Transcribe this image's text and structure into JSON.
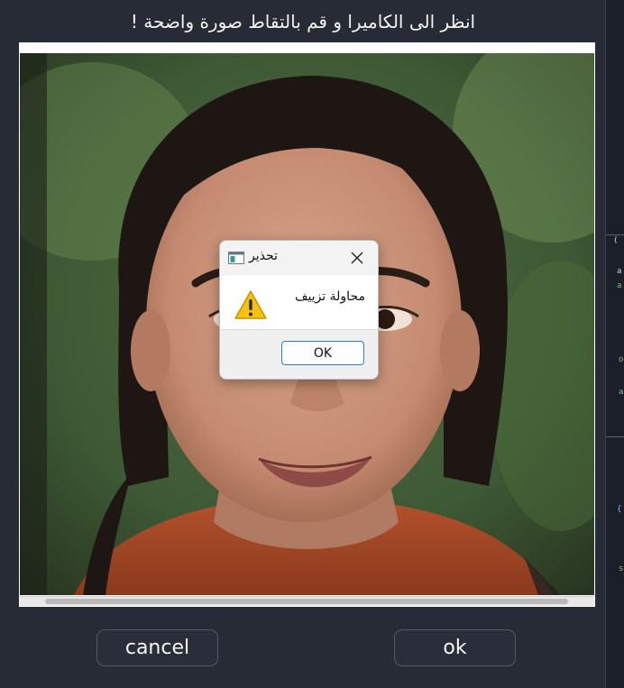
{
  "window": {
    "title": "انظر الى الكاميرا و قم بالتقاط صورة واضحة !"
  },
  "camera_preview": {
    "content": "photo",
    "scroll_fraction": 0.0
  },
  "buttons": {
    "cancel_label": "cancel",
    "ok_label": "ok"
  },
  "dialog": {
    "title": "تحذير",
    "message": "محاولة تزييف",
    "ok_label": "OK",
    "icons": {
      "app": "window-app-icon",
      "close": "close-icon",
      "warning": "warning-icon"
    }
  },
  "colors": {
    "background": "#272b36",
    "button_border": "#525866",
    "dialog_ok_border": "#2e7bd6",
    "warning_yellow": "#f5c211"
  }
}
